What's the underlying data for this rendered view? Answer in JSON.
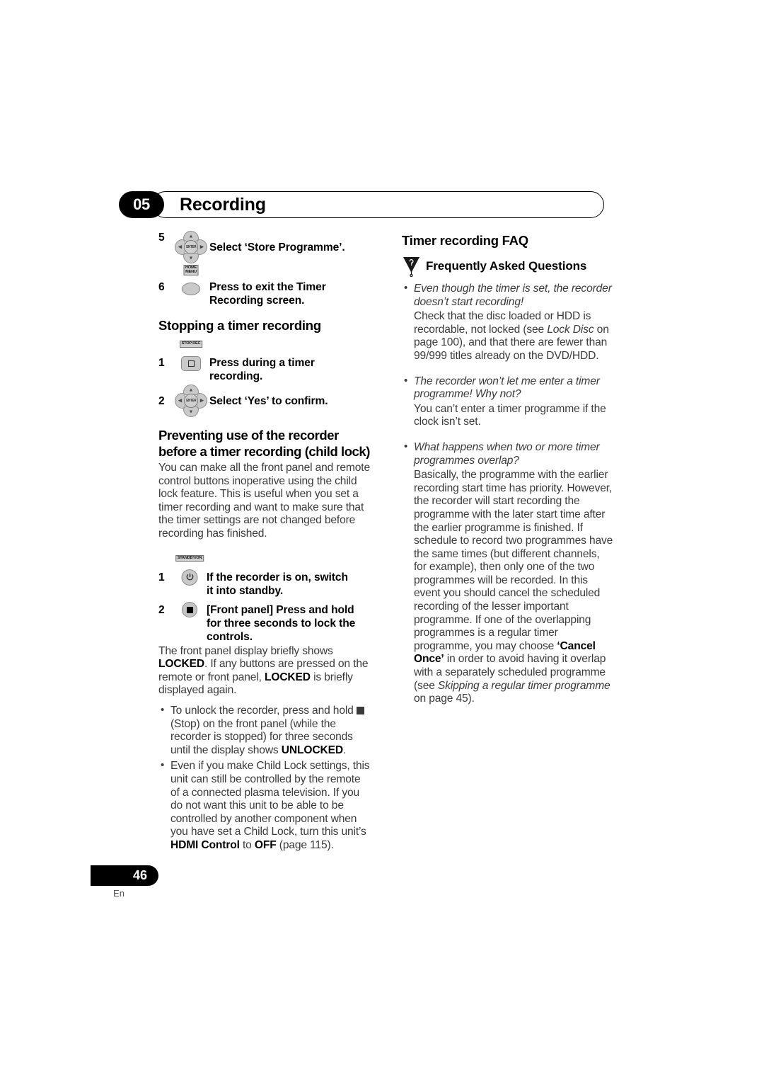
{
  "header": {
    "chapter_number": "05",
    "title": "Recording"
  },
  "left_column": {
    "step5": {
      "num": "5",
      "icon": "dpad-icon",
      "text": "Select ‘Store Programme’."
    },
    "step6": {
      "num": "6",
      "icon": "home-menu-button-icon",
      "icon_label_line1": "HOME",
      "icon_label_line2": "MENU",
      "text": "Press to exit the Timer Recording screen."
    },
    "stopping_heading": "Stopping a timer recording",
    "stop_step1": {
      "num": "1",
      "icon": "stop-rec-button-icon",
      "icon_label": "STOP REC",
      "text": "Press during a timer recording."
    },
    "stop_step2": {
      "num": "2",
      "icon": "dpad-icon",
      "text": "Select ‘Yes’ to confirm."
    },
    "preventing_heading": "Preventing use of the recorder before a timer recording (child lock)",
    "preventing_body": "You can make all the front panel and remote control buttons inoperative using the child lock feature. This is useful when you set a timer recording and want to make sure that the timer settings are not changed before recording has finished.",
    "lock_step1": {
      "num": "1",
      "icon": "standby-on-button-icon",
      "icon_label": "STANDBY/ON",
      "text": "If the recorder is on, switch it into standby."
    },
    "lock_step2": {
      "num": "2",
      "icon": "front-panel-stop-button-icon",
      "text": "[Front panel] Press and hold for three seconds to lock the controls."
    },
    "lock_note_part1": "The front panel display briefly shows ",
    "lock_note_bold1": "LOCKED",
    "lock_note_part2": ". If any buttons are pressed on the remote or front panel, ",
    "lock_note_bold2": "LOCKED",
    "lock_note_part3": " is briefly displayed again.",
    "bullet1_part1": "To unlock the recorder, press and hold ",
    "bullet1_stop_icon": "stop-square-glyph",
    "bullet1_part2": " (Stop) on the front panel (while the recorder is stopped) for three seconds until the display shows ",
    "bullet1_bold": "UNLOCKED",
    "bullet1_part3": ".",
    "bullet2_part1": "Even if you make Child Lock settings, this unit can still be controlled by the remote of a connected plasma television. If you do not want this unit to be able to be controlled by another component when you have set a Child Lock, turn this unit’s ",
    "bullet2_bold1": "HDMI Control",
    "bullet2_part2": " to ",
    "bullet2_bold2": "OFF",
    "bullet2_part3": " (page 115)."
  },
  "right_column": {
    "faq_heading": "Timer recording FAQ",
    "faq_icon": "faq-triangle-question-icon",
    "faq_subheading": "Frequently Asked Questions",
    "q1": "Even though the timer is set, the recorder doesn’t start recording!",
    "a1_part1": "Check that the disc loaded or HDD is recordable, not locked (see ",
    "a1_ital": "Lock Disc",
    "a1_part2": " on page 100), and that there are fewer than 99/999 titles already on the DVD/HDD.",
    "q2": "The recorder won’t let me enter a timer programme! Why not?",
    "a2": "You can’t enter a timer programme if the clock isn’t set.",
    "q3": "What happens when two or more timer programmes overlap?",
    "a3_part1": "Basically, the programme with the earlier recording start time has priority. However, the recorder will start recording the programme with the later start time after the earlier programme is finished. If schedule to record two programmes have the same times (but different channels, for example), then only one of the two programmes will be recorded. In this event you should cancel the scheduled recording of the lesser important programme. If one of the overlapping programmes is a regular timer programme, you may choose ",
    "a3_bold": "‘Cancel Once’",
    "a3_part2": " in order to avoid having it overlap with a separately scheduled programme (see ",
    "a3_ital": "Skipping a regular timer programme",
    "a3_part3": " on page 45)."
  },
  "footer": {
    "page_number": "46",
    "language": "En"
  }
}
